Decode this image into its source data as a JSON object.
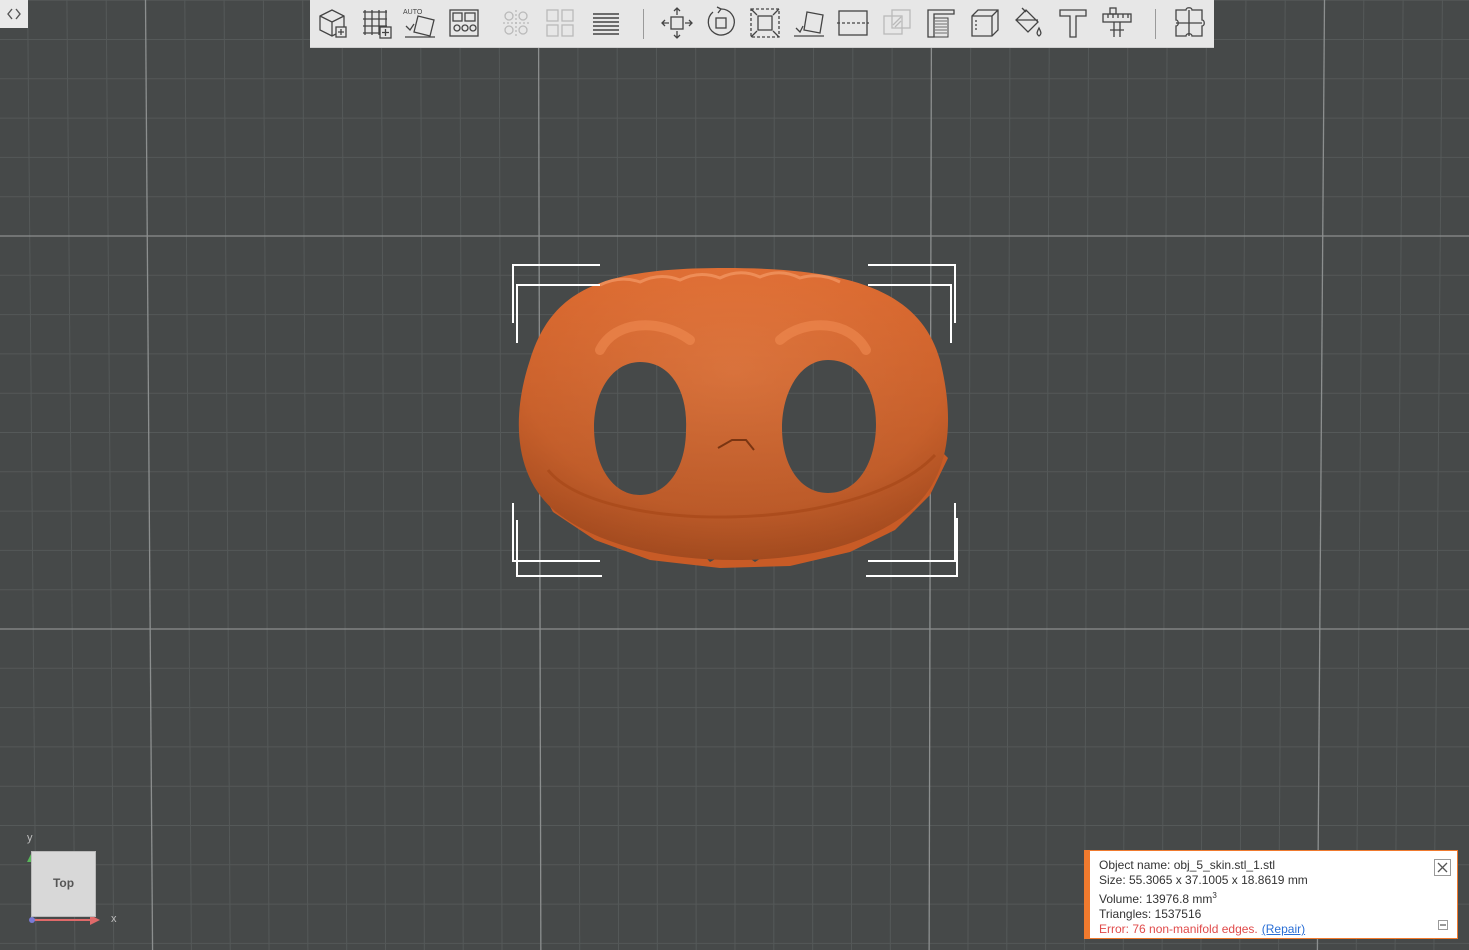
{
  "viewcube": {
    "face_label": "Top"
  },
  "axes": {
    "x_label": "x",
    "y_label": "y"
  },
  "toolbar": {
    "buttons": [
      {
        "icon": "add-model-icon"
      },
      {
        "icon": "grid-icon"
      },
      {
        "icon": "auto-orient-icon",
        "label": "AUTO"
      },
      {
        "icon": "arrange-icon"
      },
      {
        "icon": "duplicate-icon",
        "disabled": true
      },
      {
        "icon": "split-icon",
        "disabled": true
      },
      {
        "icon": "layers-icon"
      },
      {
        "icon": "move-icon"
      },
      {
        "icon": "rotate-icon"
      },
      {
        "icon": "scale-icon"
      },
      {
        "icon": "lay-flat-icon"
      },
      {
        "icon": "cut-icon"
      },
      {
        "icon": "boolean-icon",
        "disabled": true
      },
      {
        "icon": "hollow-icon"
      },
      {
        "icon": "box-icon"
      },
      {
        "icon": "paint-icon"
      },
      {
        "icon": "text-icon"
      },
      {
        "icon": "measure-icon"
      },
      {
        "icon": "puzzle-icon"
      }
    ]
  },
  "info": {
    "object_name": "Object name: obj_5_skin.stl_1.stl",
    "size": "Size: 55.3065 x 37.1005 x 18.8619 mm",
    "volume_prefix": "Volume: 13976.8 mm",
    "volume_sup": "3",
    "triangles": "Triangles: 1537516",
    "error": "Error: 76 non-manifold edges.",
    "repair": "(Repair)"
  },
  "colors": {
    "background": "#464949",
    "model": "#e06a30",
    "accent": "#f07a2e",
    "error": "#e04a4a",
    "link": "#2a6fd6"
  }
}
